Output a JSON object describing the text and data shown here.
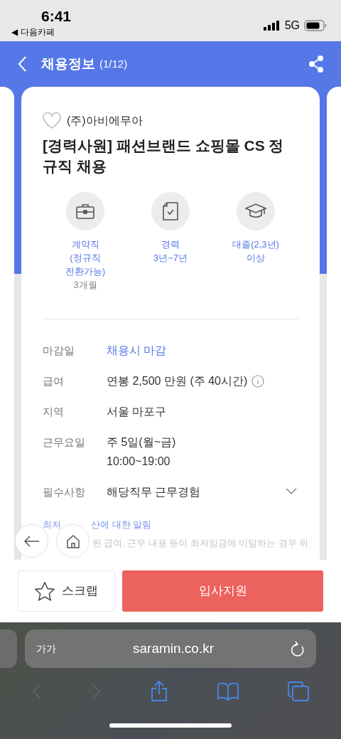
{
  "status_bar": {
    "time": "6:41",
    "back_app": "◀ 다음카페",
    "network": "5G"
  },
  "header": {
    "title": "채용정보",
    "counter": "(1/12)"
  },
  "job": {
    "company": "(주)아비에무아",
    "favorited": false,
    "title": "[경력사원] 패션브랜드 쇼핑몰 CS 정규직 채용",
    "summary": [
      {
        "kind": "briefcase",
        "lines": [
          "계약직",
          "(정규직",
          "전환가능)"
        ],
        "note": "3개월"
      },
      {
        "kind": "document",
        "lines": [
          "경력",
          "3년~7년"
        ]
      },
      {
        "kind": "education",
        "lines": [
          "대졸(2,3년)",
          "이상"
        ]
      }
    ],
    "details": [
      {
        "label": "마감일",
        "kind": "link",
        "lines": [
          "채용시 마감"
        ],
        "info": false,
        "expandable": false
      },
      {
        "label": "급여",
        "kind": "text",
        "lines": [
          "연봉 2,500 만원 (주 40시간)"
        ],
        "info": true,
        "expandable": false
      },
      {
        "label": "지역",
        "kind": "text",
        "lines": [
          "서울 마포구"
        ],
        "info": false,
        "expandable": false
      },
      {
        "label": "근무요일",
        "kind": "text",
        "lines": [
          "주 5일(월~금)",
          "10:00~19:00"
        ],
        "info": false,
        "expandable": false
      },
      {
        "label": "필수사항",
        "kind": "text",
        "lines": [
          "해당직무 근무경험"
        ],
        "info": false,
        "expandable": true
      }
    ],
    "notice_title": [
      "최저",
      "산에 대한 알림"
    ],
    "notice_body": "된 급여, 근무 내용 등이 최저임금에 미달하는 경우 위"
  },
  "actions": {
    "scrap": "스크랩",
    "apply": "입사지원"
  },
  "browser": {
    "text_size": "가가",
    "url": "saramin.co.kr"
  }
}
